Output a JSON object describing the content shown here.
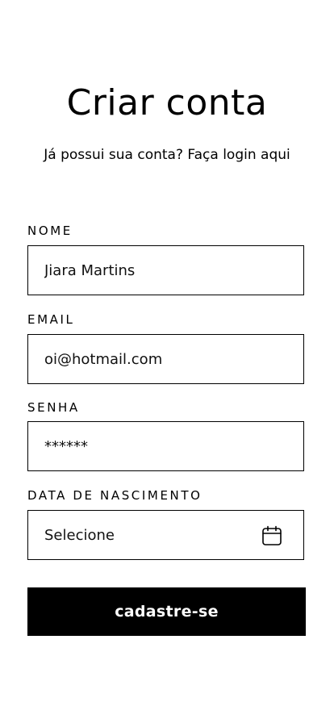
{
  "header": {
    "title": "Criar conta",
    "subtitle_prefix": "Já possui sua conta? ",
    "subtitle_link": "Faça login aqui"
  },
  "form": {
    "name": {
      "label": "NOME",
      "value": "Jiara Martins"
    },
    "email": {
      "label": "EMAIL",
      "value": "oi@hotmail.com"
    },
    "password": {
      "label": "SENHA",
      "value": "******"
    },
    "birthdate": {
      "label": "DATA DE NASCIMENTO",
      "placeholder": "Selecione",
      "icon": "calendar-icon"
    },
    "submit_label": "cadastre-se"
  },
  "colors": {
    "text": "#000000",
    "background": "#ffffff",
    "button_bg": "#000000",
    "button_text": "#ffffff"
  }
}
